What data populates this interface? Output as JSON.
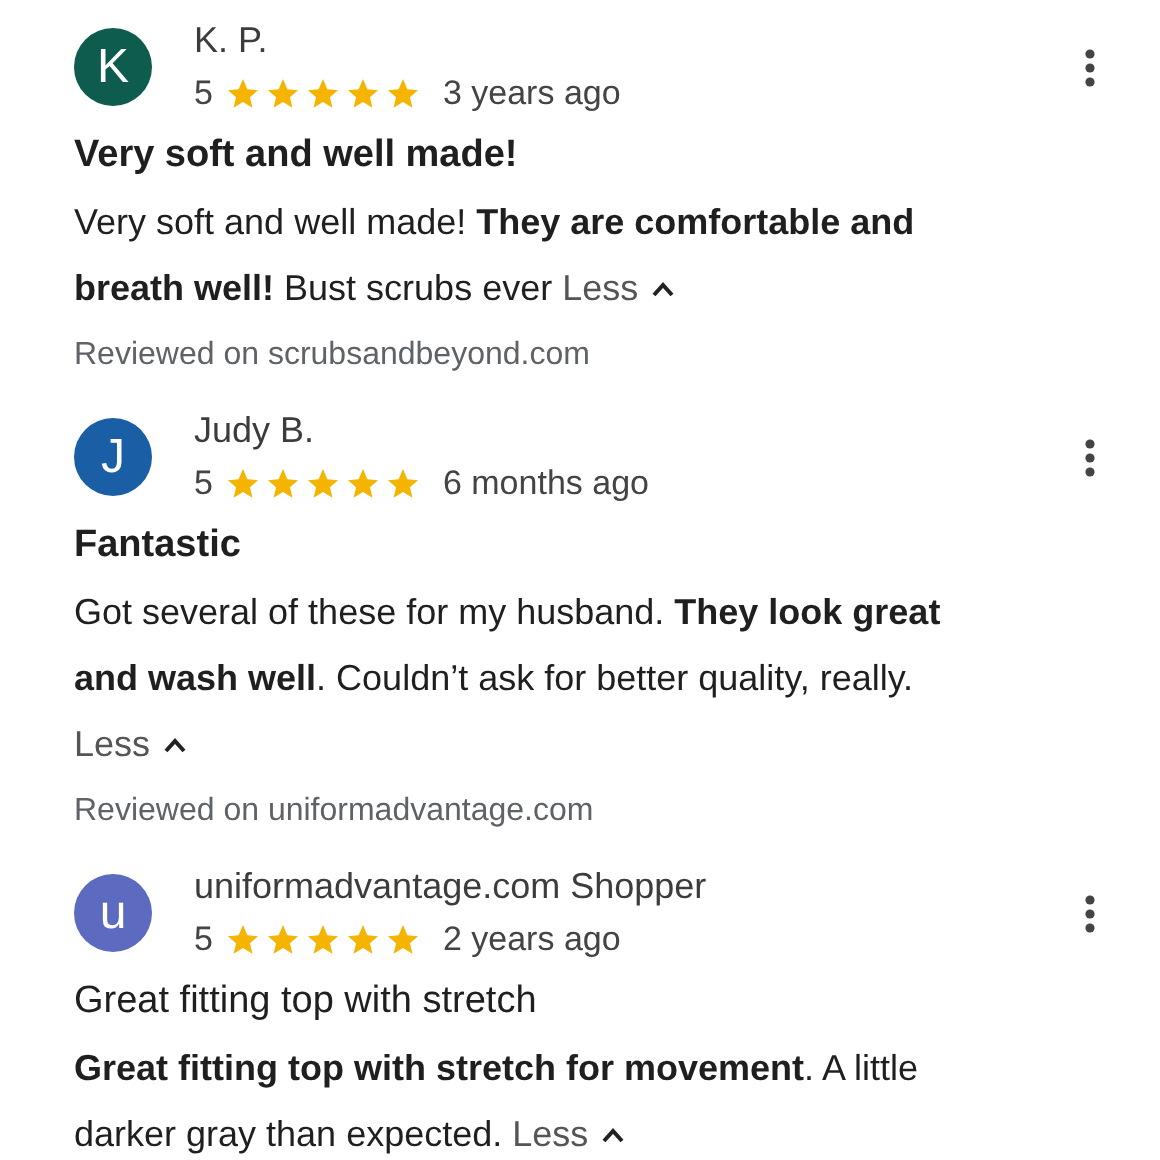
{
  "reviews": [
    {
      "avatar_letter": "K",
      "color": "#0d5c4e",
      "name": "K. P.",
      "rating": "5",
      "stars": 5,
      "time": "3 years ago",
      "title": "Very soft and well made!",
      "title_bold": true,
      "body": "Very soft and well made! **They are comfortable and breath well!** Bust scrubs ever",
      "less": "Less",
      "source": "Reviewed on scrubsandbeyond.com"
    },
    {
      "avatar_letter": "J",
      "color": "#1a5fa6",
      "name": "Judy B.",
      "rating": "5",
      "stars": 5,
      "time": "6 months ago",
      "title": "Fantastic",
      "title_bold": true,
      "body": "Got several of these for my husband. **They look great and wash well**. Couldn’t ask for better quality, really.",
      "less": "Less",
      "source": "Reviewed on uniformadvantage.com"
    },
    {
      "avatar_letter": "u",
      "color": "#5c6bc0",
      "name": "uniformadvantage.com Shopper",
      "rating": "5",
      "stars": 5,
      "time": "2 years ago",
      "title": "Great fitting top with stretch",
      "title_bold": false,
      "body": "**Great fitting top with stretch for movement**. A little darker gray than expected.",
      "less": "Less"
    }
  ]
}
